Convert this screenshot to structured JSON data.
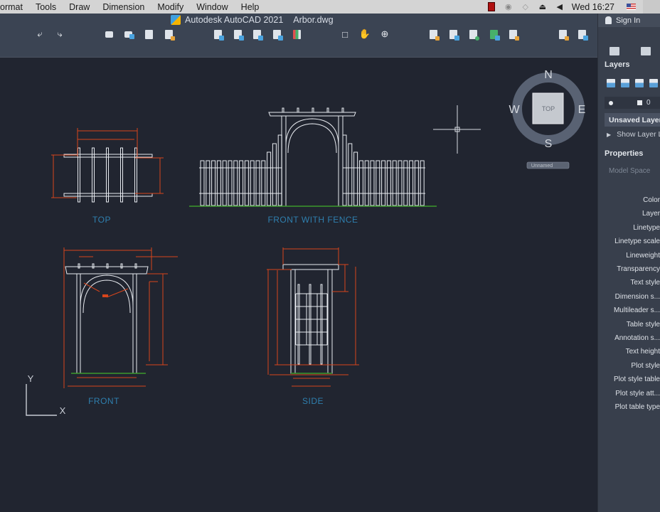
{
  "menubar": {
    "items": [
      "ormat",
      "Tools",
      "Draw",
      "Dimension",
      "Modify",
      "Window",
      "Help"
    ],
    "clock": "Wed 16:27",
    "tray_icons": [
      "record-icon",
      "camera-icon",
      "wifi-icon",
      "eject-icon",
      "volume-icon",
      "flag-us-icon"
    ]
  },
  "title": {
    "app": "Autodesk AutoCAD 2021",
    "file": "Arbor.dwg"
  },
  "toolbar": {
    "undo": "undo-icon",
    "redo": "redo-icon",
    "groups": [
      [
        "plot-icon",
        "batch-plot-icon",
        "publish-icon",
        "plot-preview-icon"
      ],
      [
        "open-sheet-set-icon",
        "layer-properties-icon",
        "block-editor-icon",
        "design-center-icon",
        "tool-palettes-icon"
      ],
      [
        "zoom-window-icon",
        "pan-icon",
        "orbit-icon"
      ],
      [
        "match-properties-icon",
        "insert-block-icon",
        "xref-icon",
        "group-icon",
        "lock-icon"
      ],
      [
        "settings-icon",
        "workspace-icon"
      ]
    ]
  },
  "viewcube": {
    "north": "N",
    "south": "S",
    "east": "E",
    "west": "W",
    "face": "TOP",
    "ucs": "Unnamed"
  },
  "drawing": {
    "labels": {
      "top": "TOP",
      "front_with_fence": "FRONT WITH FENCE",
      "front": "FRONT",
      "side": "SIDE"
    },
    "ucs_icon": {
      "x": "X",
      "y": "Y"
    },
    "colors": {
      "geometry": "#e8ebf0",
      "dimension": "#d7451c",
      "ground": "#3c9a2c",
      "label": "#2f7fae",
      "background": "#212530"
    }
  },
  "right_panel": {
    "sign_in": "Sign In",
    "layers_title": "Layers",
    "current_layer": "0",
    "layer_state": "Unsaved Layer State",
    "show_layer": "Show Layer List",
    "properties_title": "Properties",
    "model_space": "Model Space",
    "properties": [
      "Color",
      "Layer",
      "Linetype",
      "Linetype scale",
      "Lineweight",
      "Transparency",
      "Text style",
      "Dimension s...",
      "Multileader s...",
      "Table style",
      "Annotation s...",
      "Text height",
      "Plot style",
      "Plot style table",
      "Plot style att...",
      "Plot table type"
    ]
  }
}
